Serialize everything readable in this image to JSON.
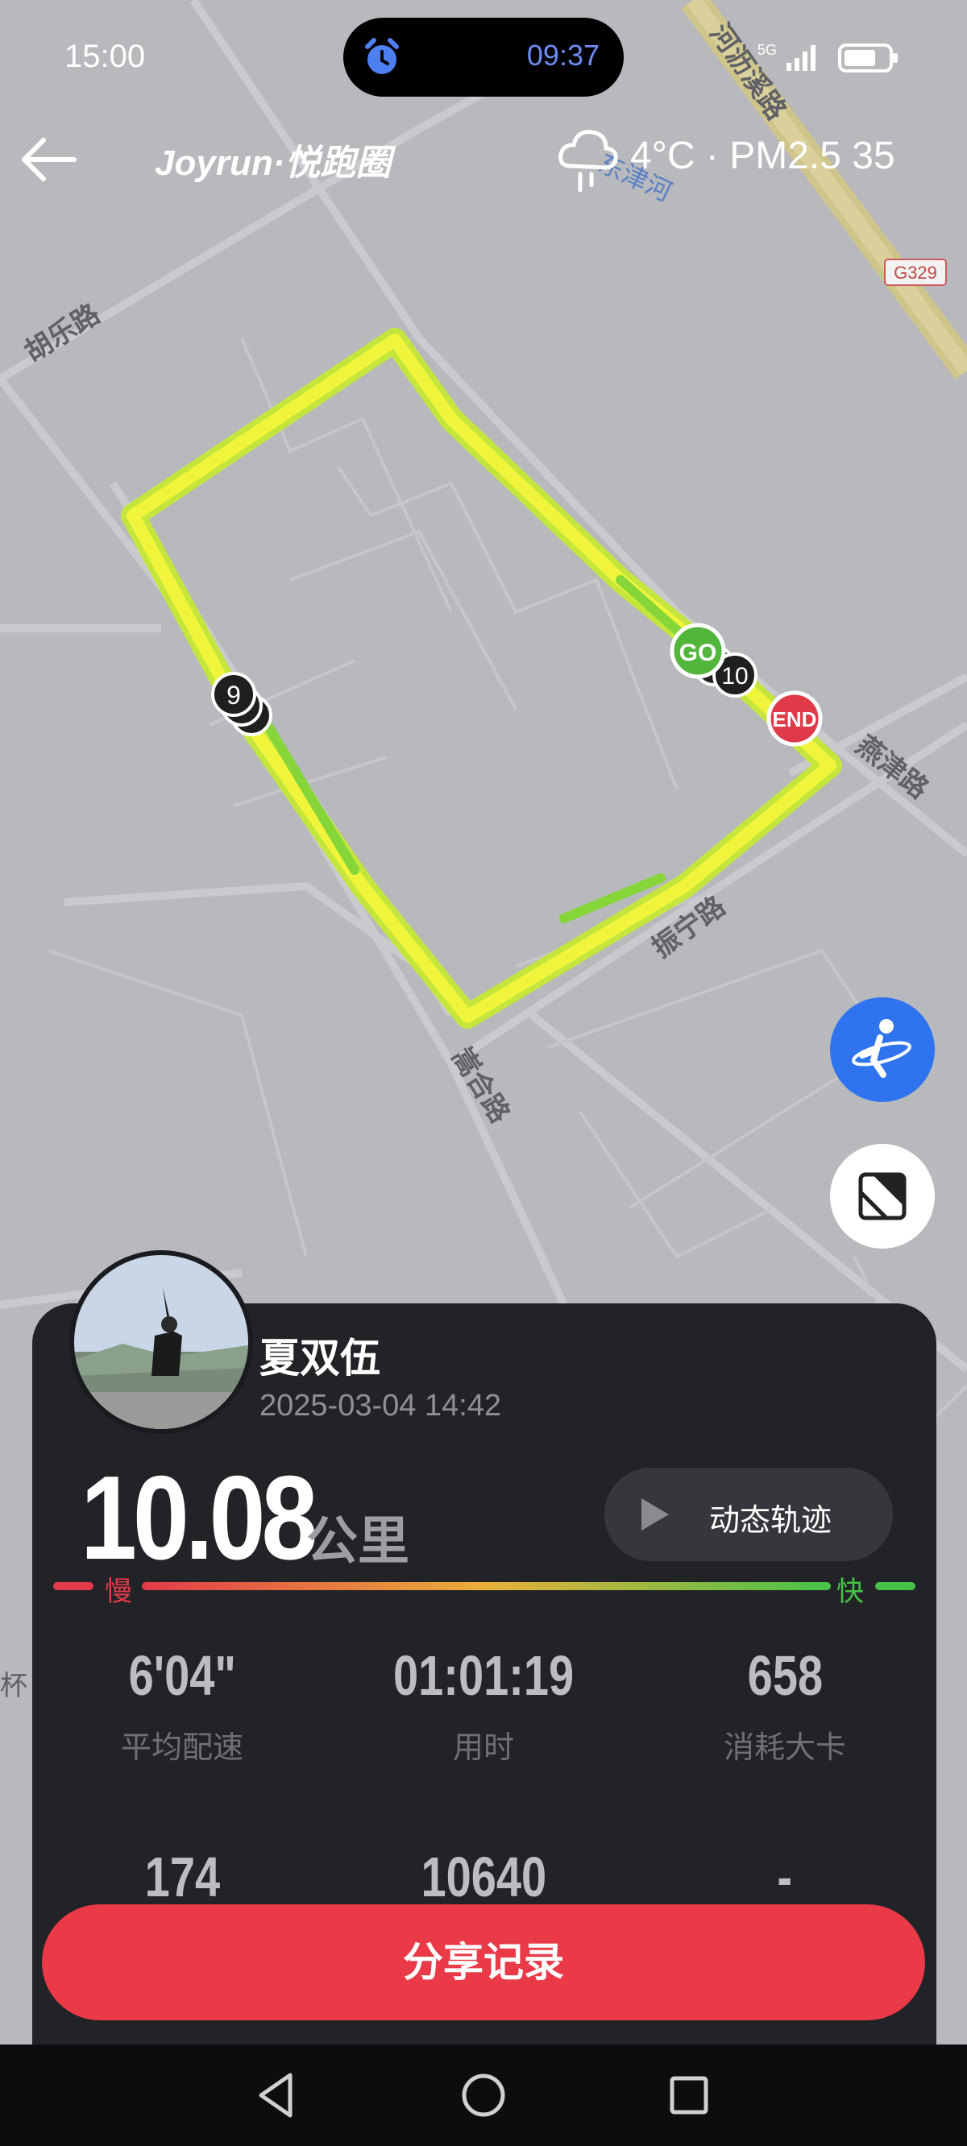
{
  "status_bar": {
    "time": "15:00",
    "alarm_time": "09:37",
    "network_label": "5G",
    "icons": [
      "alarm-icon",
      "signal-icon",
      "battery-icon"
    ]
  },
  "header": {
    "brand": "Joyrun·悦跑圈",
    "weather": "4°C · PM2.5 35",
    "weather_icon": "cloudy-icon"
  },
  "map": {
    "road_labels": [
      "河沥溪路",
      "胡乐路",
      "燕津路",
      "振宁路",
      "嵩合路",
      "东津河",
      "G329",
      "杯"
    ],
    "markers": {
      "start": "GO",
      "end": "END",
      "km_labels": [
        "9",
        "10"
      ]
    }
  },
  "run": {
    "user_name": "夏双伍",
    "datetime": "2025-03-04 14:42",
    "distance": "10.08",
    "distance_unit": "公里",
    "replay_label": "动态轨迹",
    "pace_slow": "慢",
    "pace_fast": "快",
    "stats": [
      {
        "value": "6'04\"",
        "label": "平均配速"
      },
      {
        "value": "01:01:19",
        "label": "用时"
      },
      {
        "value": "658",
        "label": "消耗大卡"
      },
      {
        "value": "174",
        "label": ""
      },
      {
        "value": "10640",
        "label": ""
      },
      {
        "value": "-",
        "label": ""
      }
    ]
  },
  "actions": {
    "share_label": "分享记录"
  },
  "colors": {
    "track_yellow": "#eef23a",
    "track_green": "#8fdc36",
    "accent_red": "#ea3a48",
    "locate_blue": "#2f74ee",
    "panel_bg": "#222327"
  }
}
